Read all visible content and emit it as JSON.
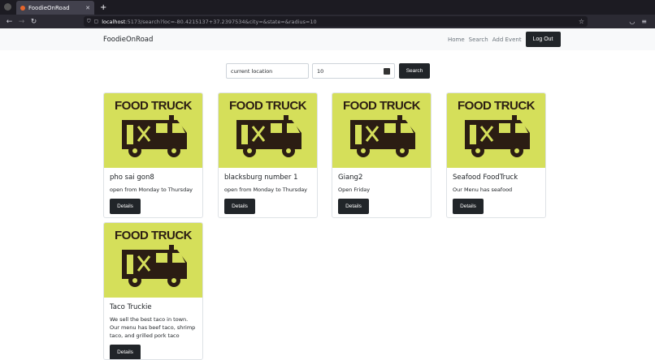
{
  "browser": {
    "tab_title": "FoodieOnRoad",
    "url_host": "localhost",
    "url_rest": ":5173/search?loc=-80.4215137+37.2397534&city=&state=&radius=10"
  },
  "nav": {
    "brand": "FoodieOnRoad",
    "links": [
      "Home",
      "Search",
      "Add Event"
    ],
    "logout": "Log Out"
  },
  "search": {
    "location_value": "current location",
    "radius_value": "10",
    "button": "Search"
  },
  "cards": [
    {
      "image_text": "FOOD TRUCK",
      "title": "pho sai gon8",
      "text": "open from Monday to Thursday",
      "button": "Details"
    },
    {
      "image_text": "FOOD TRUCK",
      "title": "blacksburg number 1",
      "text": "open from Monday to Thursday",
      "button": "Details"
    },
    {
      "image_text": "FOOD TRUCK",
      "title": "Giang2",
      "text": "Open Friday",
      "button": "Details"
    },
    {
      "image_text": "FOOD TRUCK",
      "title": "Seafood FoodTruck",
      "text": "Our Menu has seafood",
      "button": "Details"
    },
    {
      "image_text": "FOOD TRUCK",
      "title": "Taco Truckie",
      "text": "We sell the best taco in town. Our menu has beef taco, shrimp taco, and grilled pork taco",
      "button": "Details"
    }
  ],
  "colors": {
    "card_image_bg": "#d5df5a",
    "truck": "#2b1d13",
    "dark_button": "#212529"
  }
}
